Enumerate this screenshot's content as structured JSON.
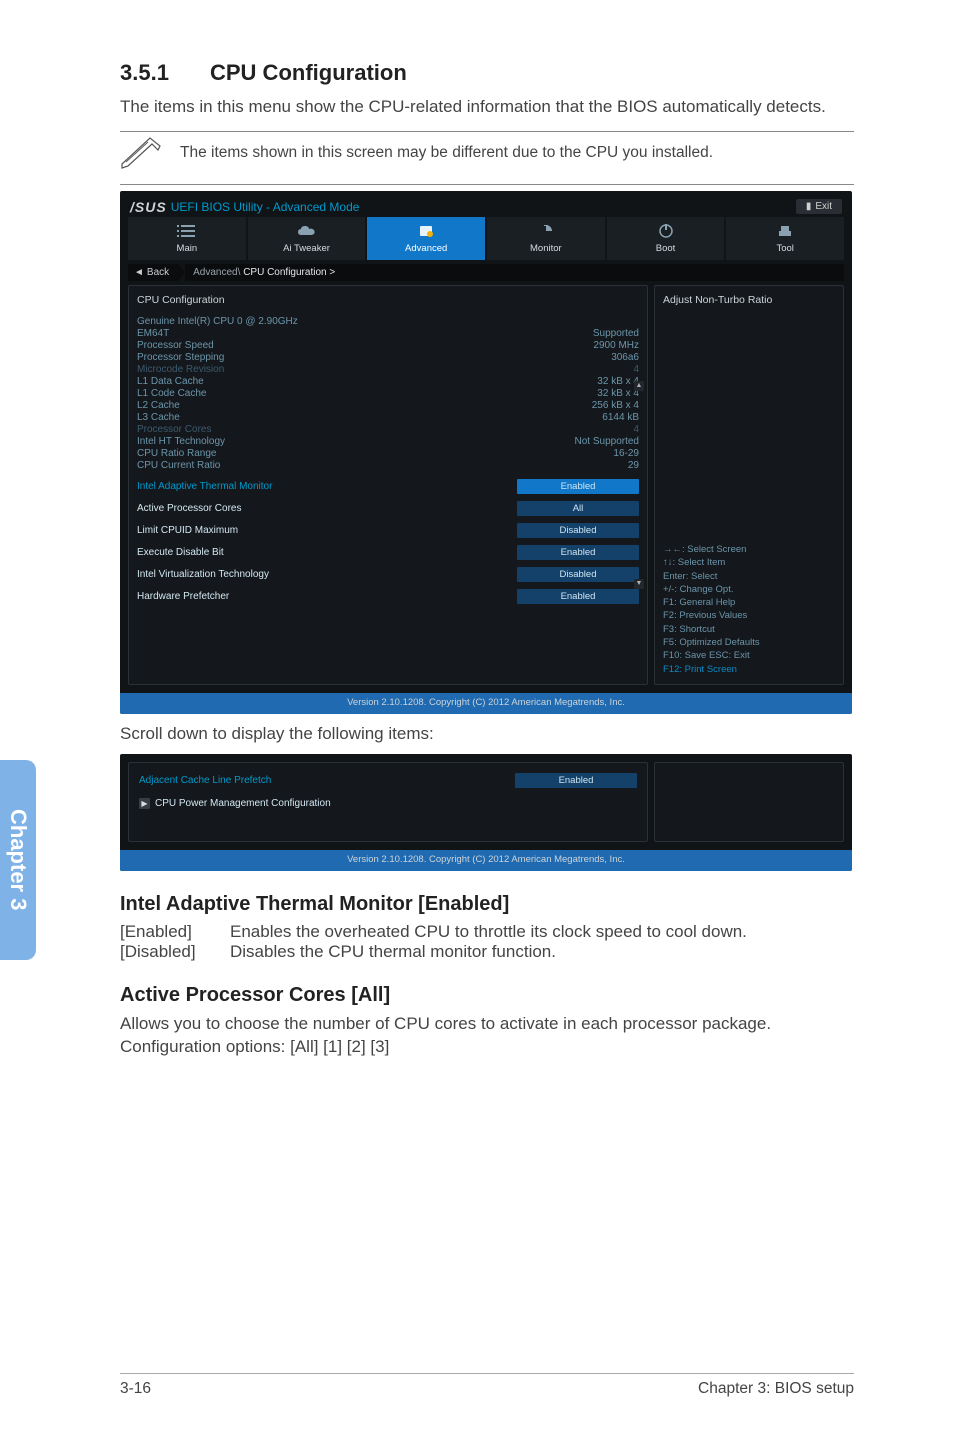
{
  "chapterTab": "Chapter 3",
  "section": {
    "num": "3.5.1",
    "title": "CPU Configuration"
  },
  "intro": "The items in this menu show the CPU-related information that the BIOS automatically detects.",
  "note": "The items shown in this screen may be different due to the CPU you installed.",
  "bios": {
    "brand": "/SUS",
    "title": "UEFI BIOS Utility - Advanced Mode",
    "exit": "Exit",
    "tabs": [
      "Main",
      "Ai Tweaker",
      "Advanced",
      "Monitor",
      "Boot",
      "Tool"
    ],
    "back": "Back",
    "crumbPrefix": "Advanced\\ ",
    "crumbActive": "CPU Configuration  >",
    "panelTitle": "CPU Configuration",
    "info": [
      {
        "l": "Genuine Intel(R)  CPU 0 @ 2.90GHz",
        "v": ""
      },
      {
        "l": "EM64T",
        "v": "Supported"
      },
      {
        "l": "Processor Speed",
        "v": "2900 MHz"
      },
      {
        "l": "Processor Stepping",
        "v": "306a6"
      },
      {
        "l": "Microcode Revision",
        "v": "4",
        "dim": true
      },
      {
        "l": "L1 Data Cache",
        "v": "32 kB x 4"
      },
      {
        "l": "L1 Code Cache",
        "v": "32 kB x 4"
      },
      {
        "l": "L2 Cache",
        "v": "256 kB x 4"
      },
      {
        "l": "L3 Cache",
        "v": "6144 kB"
      },
      {
        "l": "Processor Cores",
        "v": "4",
        "dim": true
      },
      {
        "l": "Intel HT Technology",
        "v": "Not Supported"
      },
      {
        "l": "CPU Ratio Range",
        "v": "16-29"
      },
      {
        "l": "CPU Current Ratio",
        "v": "29"
      }
    ],
    "settings": [
      {
        "l": "Intel Adaptive Thermal Monitor",
        "v": "Enabled",
        "hl": true
      },
      {
        "l": "Active Processor Cores",
        "v": "All"
      },
      {
        "l": "Limit CPUID Maximum",
        "v": "Disabled"
      },
      {
        "l": "Execute Disable Bit",
        "v": "Enabled"
      },
      {
        "l": "Intel Virtualization Technology",
        "v": "Disabled"
      },
      {
        "l": "Hardware Prefetcher",
        "v": "Enabled"
      }
    ],
    "rightTitle": "Adjust Non-Turbo Ratio",
    "help": [
      "→←:  Select Screen",
      "↑↓:  Select Item",
      "Enter:  Select",
      "+/-:  Change Opt.",
      "F1:  General Help",
      "F2:  Previous Values",
      "F3:  Shortcut",
      "F5:  Optimized Defaults",
      "F10:  Save   ESC:  Exit",
      "F12: Print Screen"
    ],
    "helpActiveIdx": 9,
    "version": "Version  2.10.1208.   Copyright  (C)  2012  American  Megatrends,  Inc."
  },
  "scrollText": "Scroll down to display the following items:",
  "bios2": {
    "row1": {
      "l": "Adjacent Cache Line Prefetch",
      "v": "Enabled"
    },
    "row2": "CPU Power Management Configuration"
  },
  "s1": {
    "h": "Intel Adaptive Thermal Monitor [Enabled]",
    "rows": [
      {
        "k": "[Enabled]",
        "v": "Enables the overheated CPU to throttle its clock speed to cool down."
      },
      {
        "k": "[Disabled]",
        "v": "Disables the CPU thermal monitor function."
      }
    ]
  },
  "s2": {
    "h": "Active Processor Cores [All]",
    "body": "Allows you to choose the number of CPU cores to activate in each processor package. Configuration options: [All] [1] [2] [3]"
  },
  "footer": {
    "l": "3-16",
    "r": "Chapter 3: BIOS setup"
  }
}
